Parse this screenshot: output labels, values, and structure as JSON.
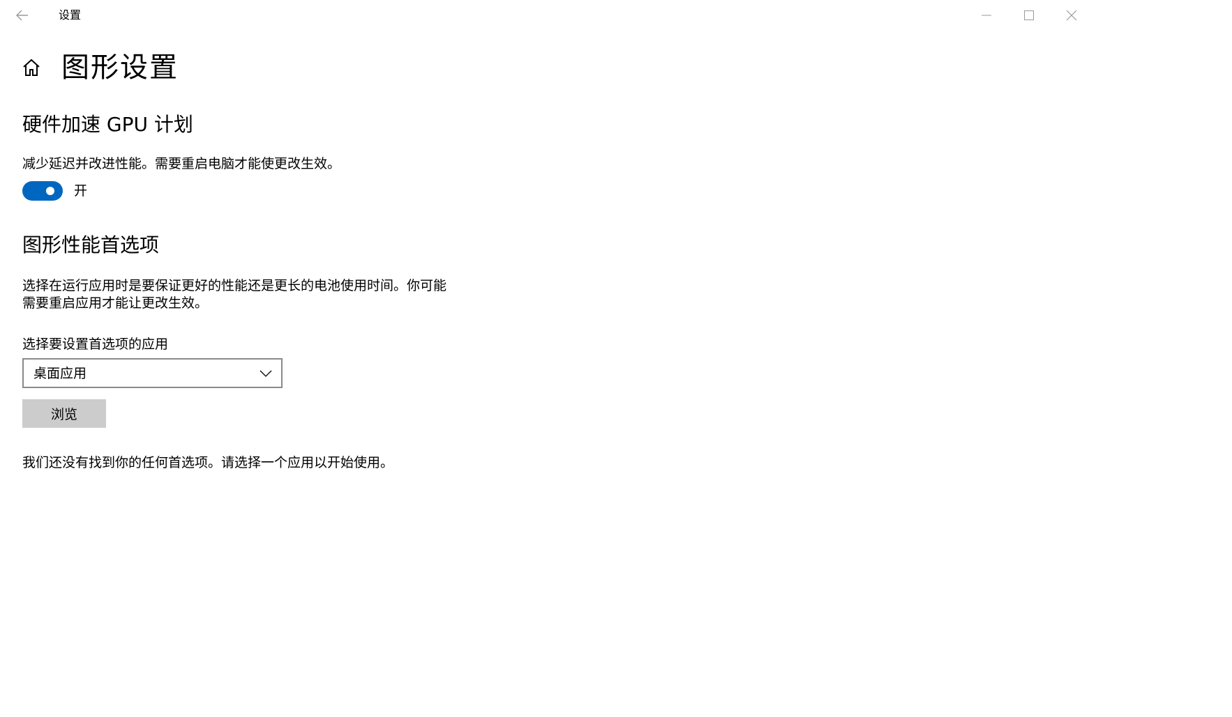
{
  "window": {
    "title": "设置",
    "controls": {
      "back_icon": "arrow-left-icon",
      "minimize_icon": "minimize-icon",
      "maximize_icon": "maximize-icon",
      "close_icon": "close-icon"
    }
  },
  "page": {
    "home_icon": "home-icon",
    "title": "图形设置"
  },
  "gpu_scheduling": {
    "heading": "硬件加速 GPU 计划",
    "description": "减少延迟并改进性能。需要重启电脑才能使更改生效。",
    "toggle_state_label": "开",
    "toggle_on": true,
    "accent_color": "#0067c0"
  },
  "graphics_preference": {
    "heading": "图形性能首选项",
    "description_line1": "选择在运行应用时是要保证更好的性能还是更长的电池使用时间。你可能",
    "description_line2": "需要重启应用才能让更改生效。",
    "select_label": "选择要设置首选项的应用",
    "dropdown_value": "桌面应用",
    "dropdown_icon": "chevron-down-icon",
    "browse_label": "浏览",
    "empty_message": "我们还没有找到你的任何首选项。请选择一个应用以开始使用。"
  }
}
